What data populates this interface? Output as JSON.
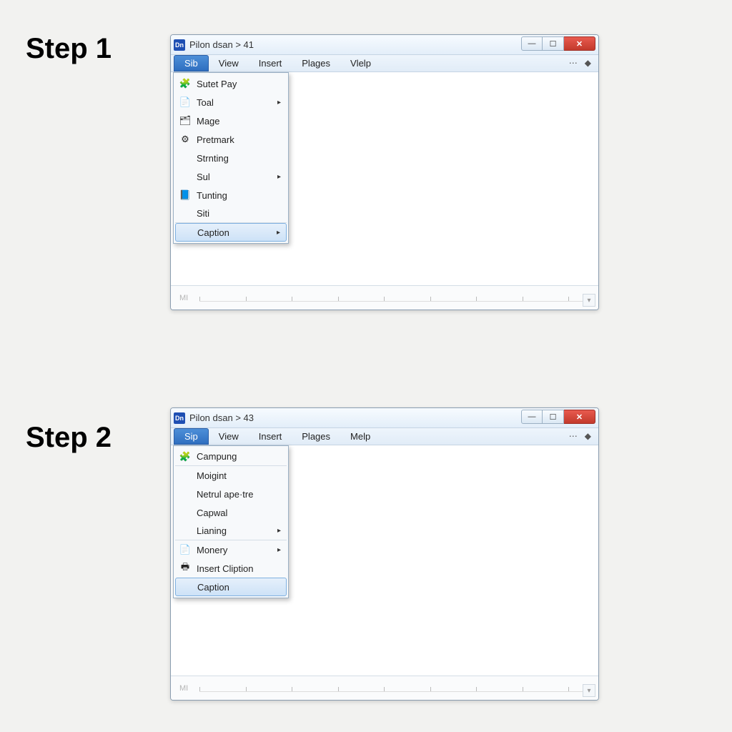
{
  "step1": {
    "label": "Step 1",
    "title": "Pilon dsan > 41",
    "app_badge": "Dn",
    "menubar": {
      "active": "Sib",
      "items": [
        "Sib",
        "View",
        "Insert",
        "Plages",
        "Vlelp"
      ]
    },
    "dropdown": [
      {
        "icon": "🧩",
        "label": "Sutet Pay",
        "sub": false
      },
      {
        "icon": "📄",
        "label": "Toal",
        "sub": true
      },
      {
        "icon": "🗂",
        "label": "Mage",
        "sub": false
      },
      {
        "icon": "⚙",
        "label": "Pretmark",
        "sub": false
      },
      {
        "icon": "",
        "label": "Strnting",
        "sub": false
      },
      {
        "icon": "",
        "label": "Sul",
        "sub": true
      },
      {
        "icon": "📘",
        "label": "Tunting",
        "sub": false
      },
      {
        "icon": "",
        "label": "Siti",
        "sub": false,
        "sep": true
      },
      {
        "icon": "",
        "label": "Caption",
        "sub": true,
        "highlight": true
      }
    ],
    "ruler_label": "MI"
  },
  "step2": {
    "label": "Step 2",
    "title": "Pilon dsan > 43",
    "app_badge": "Dn",
    "menubar": {
      "active": "Sip",
      "items": [
        "Sip",
        "View",
        "Insert",
        "Plages",
        "Melp"
      ]
    },
    "dropdown": [
      {
        "icon": "🧩",
        "label": "Campung",
        "sub": false,
        "sep": true
      },
      {
        "icon": "",
        "label": "Moigint",
        "sub": false
      },
      {
        "icon": "",
        "label": "Netrul ape·tre",
        "sub": false
      },
      {
        "icon": "",
        "label": "Capwal",
        "sub": false
      },
      {
        "icon": "",
        "label": "Lianing",
        "sub": true,
        "sep": true
      },
      {
        "icon": "📄",
        "label": "Monery",
        "sub": true
      },
      {
        "icon": "🖶",
        "label": "Insert Cliption",
        "sub": false
      },
      {
        "icon": "",
        "label": "Caption",
        "sub": false,
        "highlight": true
      }
    ],
    "ruler_label": "MI"
  },
  "window_controls": {
    "min": "—",
    "max": "☐",
    "close": "✕"
  },
  "menu_right_glyphs": {
    "a": "⋯",
    "b": "◆"
  }
}
